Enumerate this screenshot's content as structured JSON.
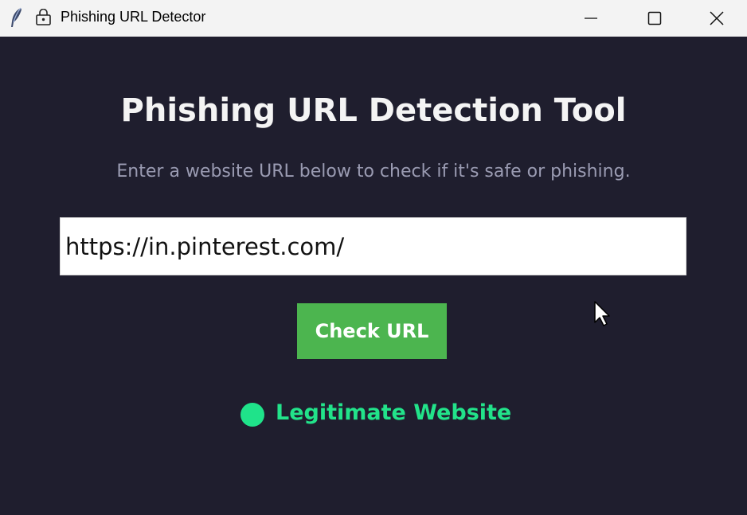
{
  "window": {
    "title": "Phishing URL Detector",
    "app_icon": "feather-icon",
    "title_icon": "lock-icon",
    "controls": [
      "minimize-icon",
      "maximize-icon",
      "close-icon"
    ]
  },
  "main": {
    "heading": "Phishing URL Detection Tool",
    "subtitle": "Enter a website URL below to check if it's safe or phishing.",
    "url_input": {
      "value": "https://in.pinterest.com/",
      "placeholder": ""
    },
    "check_button_label": "Check URL",
    "result": {
      "icon": "green-circle-icon",
      "text": "Legitimate Website",
      "color": "#22e38a"
    }
  },
  "colors": {
    "background": "#1f1e2e",
    "titlebar": "#f3f3f3",
    "button": "#4cb54f",
    "subtitle": "#9a9bb2"
  }
}
